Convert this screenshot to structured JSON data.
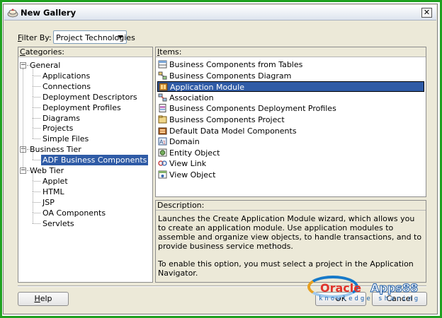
{
  "window": {
    "title": "New Gallery",
    "close_glyph": "✕"
  },
  "filter": {
    "label_prefix": "",
    "label_accel": "F",
    "label_rest": "ilter By:",
    "value": "Project Technologies"
  },
  "categories": {
    "header_accel": "C",
    "header_rest": "ategories:",
    "tree": [
      {
        "label": "General",
        "level": 0,
        "expanded": true
      },
      {
        "label": "Applications",
        "level": 1
      },
      {
        "label": "Connections",
        "level": 1
      },
      {
        "label": "Deployment Descriptors",
        "level": 1
      },
      {
        "label": "Deployment Profiles",
        "level": 1
      },
      {
        "label": "Diagrams",
        "level": 1
      },
      {
        "label": "Projects",
        "level": 1
      },
      {
        "label": "Simple Files",
        "level": 1
      },
      {
        "label": "Business Tier",
        "level": 0,
        "expanded": true
      },
      {
        "label": "ADF Business Components",
        "level": 1,
        "selected": true
      },
      {
        "label": "Web Tier",
        "level": 0,
        "expanded": true
      },
      {
        "label": "Applet",
        "level": 1
      },
      {
        "label": "HTML",
        "level": 1
      },
      {
        "label": "JSP",
        "level": 1
      },
      {
        "label": "OA Components",
        "level": 1
      },
      {
        "label": "Servlets",
        "level": 1
      }
    ]
  },
  "items": {
    "header_accel": "I",
    "header_rest": "tems:",
    "list": [
      {
        "label": "Business Components from Tables",
        "icon": "bc-tables-icon"
      },
      {
        "label": "Business Components Diagram",
        "icon": "bc-diagram-icon"
      },
      {
        "label": "Application Module",
        "icon": "application-module-icon",
        "selected": true
      },
      {
        "label": "Association",
        "icon": "association-icon"
      },
      {
        "label": "Business Components Deployment Profiles",
        "icon": "deployment-profile-icon"
      },
      {
        "label": "Business Components Project",
        "icon": "bc-project-icon"
      },
      {
        "label": "Default Data Model Components",
        "icon": "data-model-icon"
      },
      {
        "label": "Domain",
        "icon": "domain-icon"
      },
      {
        "label": "Entity Object",
        "icon": "entity-object-icon"
      },
      {
        "label": "View Link",
        "icon": "view-link-icon"
      },
      {
        "label": "View Object",
        "icon": "view-object-icon"
      }
    ]
  },
  "description": {
    "header": "Description:",
    "paragraph1": "Launches the Create Application Module wizard, which allows you to create an application module. Use application modules to assemble and organize view objects, to handle transactions, and to provide business service methods.",
    "paragraph2": "To enable this option, you must select a project in the Application Navigator."
  },
  "buttons": {
    "help_accel": "H",
    "help_rest": "elp",
    "ok": "OK",
    "cancel": "Cancel"
  },
  "watermark": {
    "brand_left": "Oracle",
    "brand_right": "Apps88",
    "tagline": "knowledge sharing"
  },
  "colors": {
    "selection": "#2f5ba6",
    "frame_border": "#1fa11f",
    "dialog_bg": "#ece9d8"
  }
}
